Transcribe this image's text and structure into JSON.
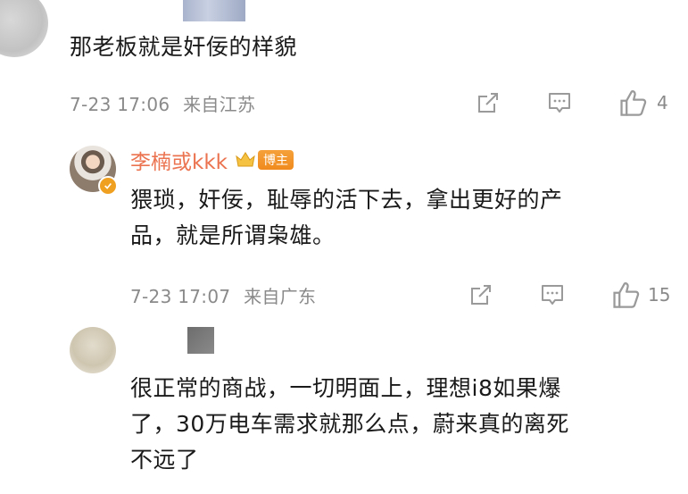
{
  "comments": [
    {
      "text": "那老板就是奸佞的样貌",
      "time": "7-23 17:06",
      "location": "来自江苏",
      "likes": "4"
    },
    {
      "username": "李楠或kkk",
      "badge": "博主",
      "text_line1": "猥琐，奸佞，耻辱的活下去，拿出更好的产",
      "text_line2": "品，就是所谓枭雄。",
      "time": "7-23 17:07",
      "location": "来自广东",
      "likes": "15"
    },
    {
      "text_line1": "很正常的商战，一切明面上，理想i8如果爆",
      "text_line2": "了，30万电车需求就那么点，蔚来真的离死",
      "text_line3": "不远了"
    }
  ],
  "colors": {
    "username": "#eb7350",
    "badge": "#f08a1e",
    "meta_text": "#8a8a8a",
    "icon": "#9a9a9a"
  },
  "icons": [
    "share-icon",
    "comment-icon",
    "like-icon",
    "crown-icon",
    "verified-badge-icon"
  ]
}
